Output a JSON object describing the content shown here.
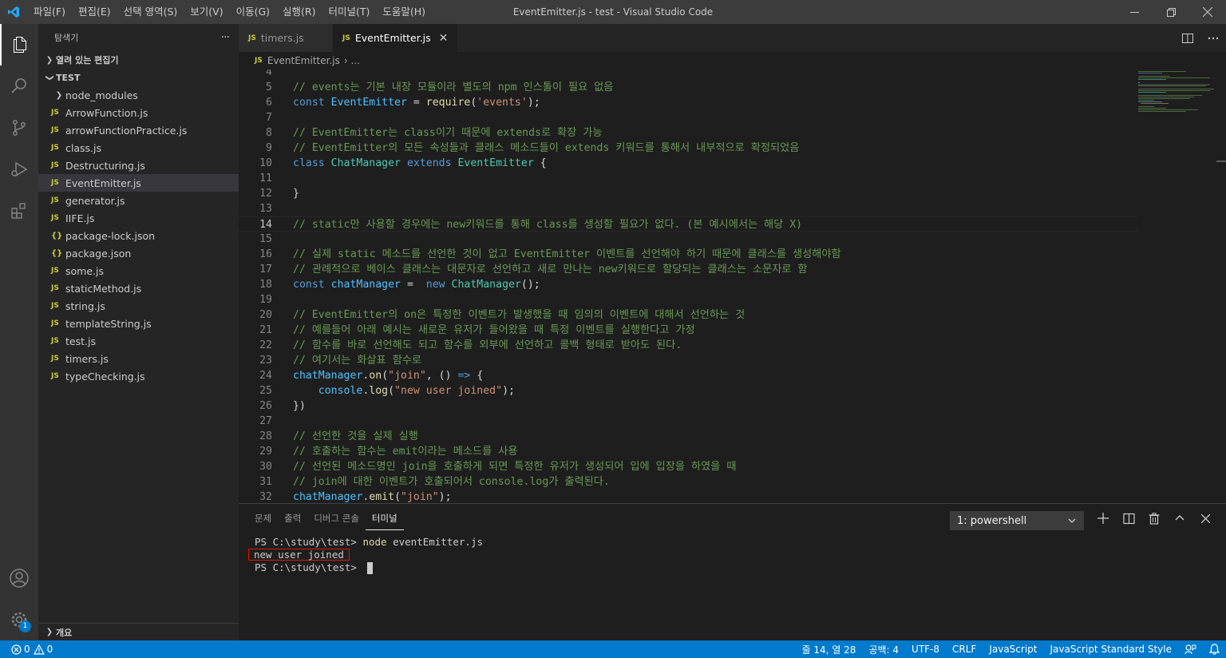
{
  "titlebar": {
    "menu": [
      "파일(F)",
      "편집(E)",
      "선택 영역(S)",
      "보기(V)",
      "이동(G)",
      "실행(R)",
      "터미널(T)",
      "도움말(H)"
    ],
    "window_title": "EventEmitter.js - test - Visual Studio Code"
  },
  "sidebar": {
    "title": "탐색기",
    "more": "···",
    "open_editors": "열려 있는 편집기",
    "folder": "TEST",
    "items": [
      {
        "label": "node_modules",
        "icon": "folder"
      },
      {
        "label": "ArrowFunction.js",
        "icon": "JS"
      },
      {
        "label": "arrowFunctionPractice.js",
        "icon": "JS"
      },
      {
        "label": "class.js",
        "icon": "JS"
      },
      {
        "label": "Destructuring.js",
        "icon": "JS"
      },
      {
        "label": "EventEmitter.js",
        "icon": "JS"
      },
      {
        "label": "generator.js",
        "icon": "JS"
      },
      {
        "label": "IIFE.js",
        "icon": "JS"
      },
      {
        "label": "package-lock.json",
        "icon": "{}"
      },
      {
        "label": "package.json",
        "icon": "{}"
      },
      {
        "label": "some.js",
        "icon": "JS"
      },
      {
        "label": "staticMethod.js",
        "icon": "JS"
      },
      {
        "label": "string.js",
        "icon": "JS"
      },
      {
        "label": "templateString.js",
        "icon": "JS"
      },
      {
        "label": "test.js",
        "icon": "JS"
      },
      {
        "label": "timers.js",
        "icon": "JS"
      },
      {
        "label": "typeChecking.js",
        "icon": "JS"
      }
    ],
    "outline": "개요"
  },
  "activity": {
    "badge": "1"
  },
  "tabs": [
    {
      "label": "timers.js",
      "icon": "JS"
    },
    {
      "label": "EventEmitter.js",
      "icon": "JS",
      "close": "✕"
    }
  ],
  "breadcrumbs": {
    "file": "EventEmitter.js",
    "rest": "› ..."
  },
  "code": {
    "line_numbers": [
      "4",
      "5",
      "6",
      "7",
      "8",
      "9",
      "10",
      "11",
      "12",
      "13",
      "14",
      "15",
      "16",
      "17",
      "18",
      "19",
      "20",
      "21",
      "22",
      "23",
      "24",
      "25",
      "26",
      "27",
      "28",
      "29",
      "30",
      "31",
      "32"
    ],
    "l5": "// events는 기본 내장 모듈이라 별도의 npm 인스톨이 필요 없음",
    "l6": [
      "const",
      " ",
      "EventEmitter",
      " = ",
      "require",
      "(",
      "'events'",
      ");"
    ],
    "l8": "// EventEmitter는 class이기 때문에 extends로 확장 가능",
    "l9": "// EventEmitter의 모든 속성들과 클래스 메소드들이 extends 키워드를 통해서 내부적으로 확정되었음",
    "l10": [
      "class",
      " ",
      "ChatManager",
      " ",
      "extends",
      " ",
      "EventEmitter",
      " {"
    ],
    "l12": "}",
    "l14": "// static만 사용할 경우에는 new키워드를 통해 class를 생성할 필요가 없다. (본 예시에서는 해당 X)",
    "l16": "// 실제 static 메소드를 선언한 것이 없고 EventEmitter 이벤트를 선언해야 하기 때문에 클래스를 생성해야함",
    "l17": "// 관례적으로 베이스 클래스는 대문자로 선언하고 새로 만나는 new키워드로 할당되는 클래스는 소문자로 함",
    "l18": [
      "const",
      " ",
      "chatManager",
      " =  ",
      "new",
      " ",
      "ChatManager",
      "();"
    ],
    "l20": "// EventEmitter의 on은 특정한 이벤트가 발생했을 때 임의의 이벤트에 대해서 선언하는 것",
    "l21": "// 예를들어 아래 예시는 새로운 유저가 들어왔을 때 특정 이벤트를 실행한다고 가정",
    "l22": "// 함수를 바로 선언해도 되고 함수를 외부에 선언하고 콜백 형태로 받아도 된다.",
    "l23": "// 여기서는 화살표 함수로",
    "l24": [
      "chatManager",
      ".",
      "on",
      "(",
      "\"join\"",
      ", () ",
      "=>",
      " {"
    ],
    "l25": [
      "    ",
      "console",
      ".",
      "log",
      "(",
      "\"new user joined\"",
      ");"
    ],
    "l26": "})",
    "l28": "// 선언한 것을 실제 실행",
    "l29": "// 호출하는 함수는 emit이라는 메소드를 사용",
    "l30": "// 선언된 메소드명인 join을 호출하게 되면 특정한 유저가 생성되어 입에 입장을 하였을 때",
    "l31": "// join에 대한 이벤트가 호출되어서 console.log가 출력된다.",
    "l32": [
      "chatManager",
      ".",
      "emit",
      "(",
      "\"join\"",
      ");"
    ]
  },
  "panel": {
    "tabs": [
      "문제",
      "출력",
      "디버그 콘솔",
      "터미널"
    ],
    "terminal_select": "1: powershell",
    "terminal": {
      "prompt1": "PS C:\\study\\test> ",
      "cmd1": "node",
      "arg1": " eventEmitter.js",
      "output": "new user joined",
      "prompt2": "PS C:\\study\\test> "
    }
  },
  "statusbar": {
    "errors": "0",
    "warnings": "0",
    "position": "줄 14, 열 28",
    "spaces": "공백: 4",
    "encoding": "UTF-8",
    "eol": "CRLF",
    "language": "JavaScript",
    "style": "JavaScript Standard Style"
  },
  "colors": {
    "accent": "#007acc",
    "titlebar": "#3c3c3c",
    "sidebar": "#252526",
    "editor": "#1e1e1e"
  }
}
